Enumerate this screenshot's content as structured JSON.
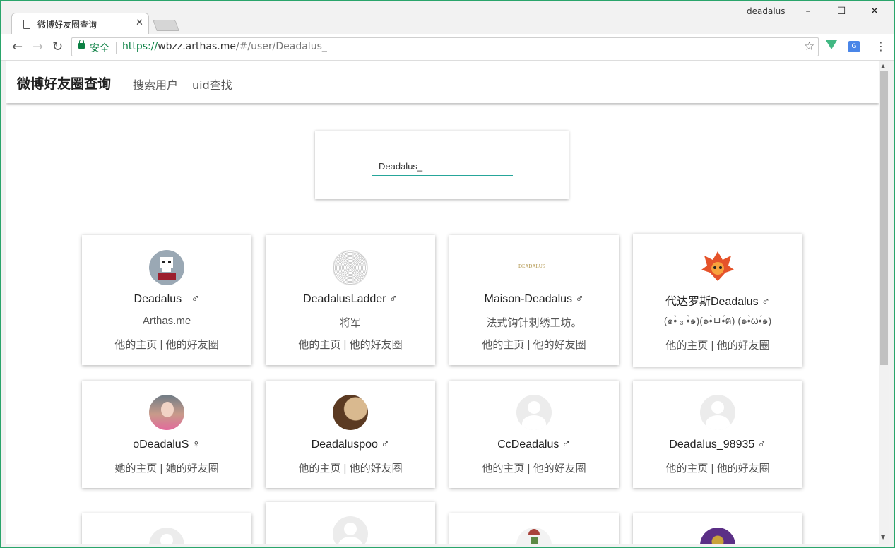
{
  "browser": {
    "tab_title": "微博好友圈查询",
    "profile_name": "deadalus",
    "secure_label": "安全",
    "url_scheme": "https://",
    "url_host": "wbzz.arthas.me",
    "url_path": "/#/user/Deadalus_",
    "window_buttons": [
      "minimize",
      "maximize",
      "close"
    ]
  },
  "navbar": {
    "brand": "微博好友圈查询",
    "links": [
      "搜索用户",
      "uid查找"
    ]
  },
  "search": {
    "value": "Deadalus_"
  },
  "users": [
    {
      "name": "Deadalus_",
      "gender": "♂",
      "desc": "Arthas.me",
      "home": "他的主页",
      "circle": "他的好友圈",
      "avatar": "skull-avatar"
    },
    {
      "name": "DeadalusLadder",
      "gender": "♂",
      "desc": "将军",
      "home": "他的主页",
      "circle": "他的好友圈",
      "avatar": "dots-avatar"
    },
    {
      "name": "Maison-Deadalus",
      "gender": "♂",
      "desc": "法式钩针刺绣工坊。",
      "home": "他的主页",
      "circle": "他的好友圈",
      "avatar": "logo-avatar",
      "logo_text": "DEADALUS"
    },
    {
      "name": "代达罗斯Deadalus",
      "gender": "♂",
      "desc": "(๑•̀ ₃ •̀๑)(๑•̀ㅁ•́ฅ) (๑•̀ω•́๑)",
      "home": "他的主页",
      "circle": "他的好友圈",
      "avatar": "fox-avatar"
    },
    {
      "name": "oDeadaluS",
      "gender": "♀",
      "desc": "",
      "home": "她的主页",
      "circle": "她的好友圈",
      "avatar": "photo-avatar"
    },
    {
      "name": "Deadaluspoo",
      "gender": "♂",
      "desc": "",
      "home": "他的主页",
      "circle": "他的好友圈",
      "avatar": "moon-avatar"
    },
    {
      "name": "CcDeadalus",
      "gender": "♂",
      "desc": "",
      "home": "他的主页",
      "circle": "他的好友圈",
      "avatar": "default-avatar"
    },
    {
      "name": "Deadalus_98935",
      "gender": "♂",
      "desc": "",
      "home": "他的主页",
      "circle": "他的好友圈",
      "avatar": "default-avatar"
    }
  ],
  "link_separator": "|",
  "colors": {
    "accent": "#26a69a",
    "secure": "#0b8043",
    "frame": "#2aa56b"
  }
}
